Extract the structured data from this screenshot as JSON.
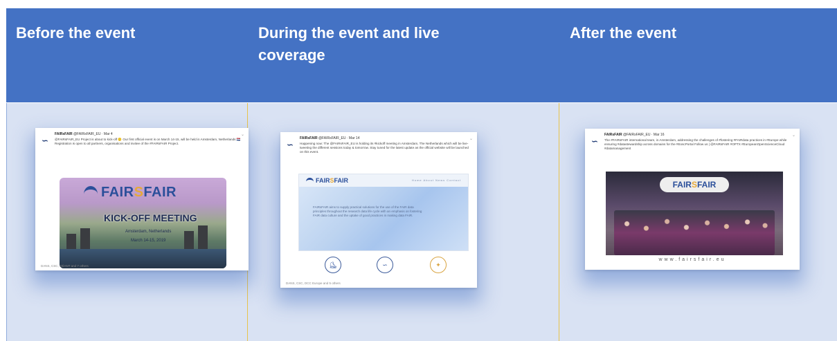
{
  "columns": {
    "before": "Before the event",
    "during": "During the event and live coverage",
    "after": "After the event"
  },
  "tweets": {
    "before": {
      "author": "FAIRsFAIR",
      "handle": "@FAIRsFAIR_EU · Mar 4",
      "text": "@FAIRsFAIR_EU Project is about to kick-off 🙂 Our first official event is on March 14-15, will be held in Amsterdam, Netherlands 🇳🇱 Registration is open to all partners, organisations and invitee of the #FAIRsFAIR Project.",
      "image_brand_left": "FAIR",
      "image_brand_s": "S",
      "image_brand_right": "FAIR",
      "image_title": "KICK-OFF MEETING",
      "image_sub1": "Amsterdam, Netherlands",
      "image_sub2": "March 14-15, 2019",
      "stats": "DANS, CSC, GÉANT and 7 others"
    },
    "during": {
      "author": "FAIRsFAIR",
      "handle": "@FAIRsFAIR_EU · Mar 14",
      "text": "Happening now: The @FAIRsFAIR_EU is holding its #kickoff meeting in Amsterdam, The Netherlands which will be live-tweeting the different sessions today & tomorrow. Stay tuned for the latest update as the official website will be launched on this event.",
      "site_brand_left": "FAIR",
      "site_brand_s": "S",
      "site_brand_right": "FAIR",
      "site_nav": "Home   About   News   Contact",
      "site_blurb": "FAIRsFAIR aims to supply practical solutions for the use of the FAIR data principles throughout the research data life cycle with an emphasis on fostering FAIR data culture and the uptake of good practices in making data FAIR.",
      "stats": "DANS, CSC, DCC Europe and 5 others"
    },
    "after": {
      "author": "FAIRsFAIR",
      "handle": "@FAIRsFAIR_EU · Mar 16",
      "text": "The #FAIRsFAIR international team, in Amsterdam, addressing the challenges of #fostering #FAIRdata practices in #Europe while ensuring #datastewardship across domains for the #EoscPortal Follow us | @FAIRsFAIR #OPTX #EuropeanOpenScienceCloud #datamanagement",
      "photo_brand_left": "FAIR",
      "photo_brand_s": "S",
      "photo_brand_right": "FAIR",
      "photo_caption": "www.fairsfair.eu"
    }
  },
  "colors": {
    "header": "#4472c4",
    "body": "#d9e2f3",
    "divider": "#e8c34a"
  }
}
